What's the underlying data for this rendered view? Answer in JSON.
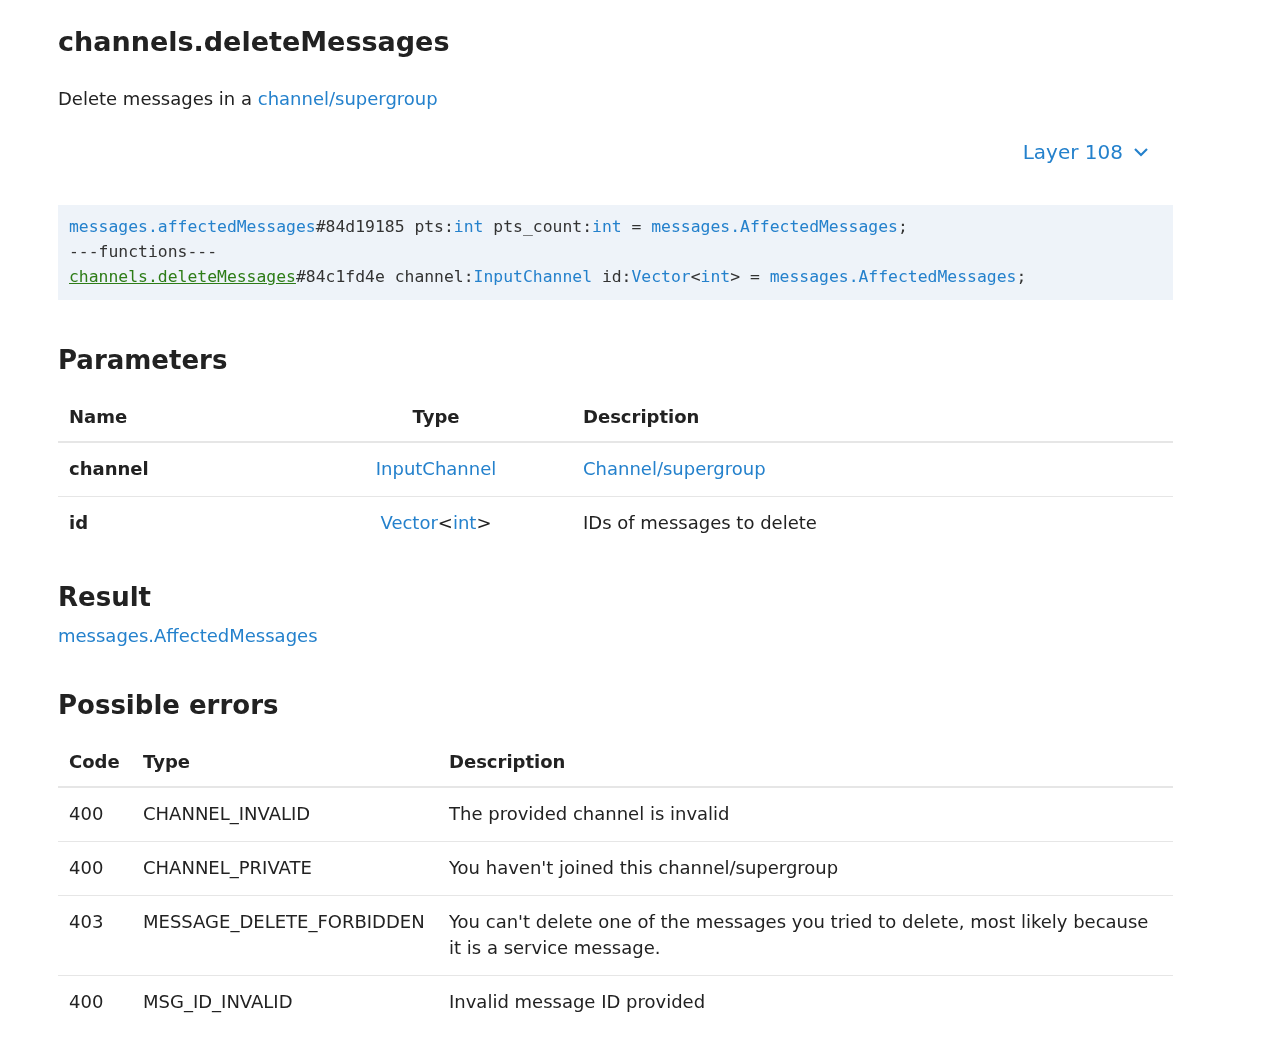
{
  "title": "channels.deleteMessages",
  "description": [
    {
      "kind": "plain",
      "text": "Delete messages in a "
    },
    {
      "kind": "link",
      "text": "channel/supergroup"
    }
  ],
  "layer_selector": {
    "label": "Layer 108"
  },
  "schema": [
    [
      {
        "kind": "link",
        "text": "messages.affectedMessages"
      },
      {
        "kind": "plain",
        "text": "#84d19185 pts:"
      },
      {
        "kind": "link",
        "text": "int"
      },
      {
        "kind": "plain",
        "text": " pts_count:"
      },
      {
        "kind": "link",
        "text": "int"
      },
      {
        "kind": "plain",
        "text": " = "
      },
      {
        "kind": "link",
        "text": "messages.AffectedMessages"
      },
      {
        "kind": "plain",
        "text": ";"
      }
    ],
    [
      {
        "kind": "plain",
        "text": "---functions---"
      }
    ],
    [
      {
        "kind": "current",
        "text": "channels.deleteMessages"
      },
      {
        "kind": "plain",
        "text": "#84c1fd4e channel:"
      },
      {
        "kind": "link",
        "text": "InputChannel"
      },
      {
        "kind": "plain",
        "text": " id:"
      },
      {
        "kind": "link",
        "text": "Vector"
      },
      {
        "kind": "plain",
        "text": "<"
      },
      {
        "kind": "link",
        "text": "int"
      },
      {
        "kind": "plain",
        "text": "> = "
      },
      {
        "kind": "link",
        "text": "messages.AffectedMessages"
      },
      {
        "kind": "plain",
        "text": ";"
      }
    ]
  ],
  "parameters": {
    "heading": "Parameters",
    "columns": [
      "Name",
      "Type",
      "Description"
    ],
    "rows": [
      {
        "name": "channel",
        "type": [
          {
            "kind": "link",
            "text": "InputChannel"
          }
        ],
        "description": [
          {
            "kind": "link",
            "text": "Channel/supergroup"
          }
        ]
      },
      {
        "name": "id",
        "type": [
          {
            "kind": "link",
            "text": "Vector"
          },
          {
            "kind": "plain",
            "text": "<"
          },
          {
            "kind": "link",
            "text": "int"
          },
          {
            "kind": "plain",
            "text": ">"
          }
        ],
        "description": [
          {
            "kind": "plain",
            "text": "IDs of messages to delete"
          }
        ]
      }
    ]
  },
  "result": {
    "heading": "Result",
    "type": "messages.AffectedMessages"
  },
  "errors": {
    "heading": "Possible errors",
    "columns": [
      "Code",
      "Type",
      "Description"
    ],
    "rows": [
      {
        "code": "400",
        "type": "CHANNEL_INVALID",
        "description": "The provided channel is invalid"
      },
      {
        "code": "400",
        "type": "CHANNEL_PRIVATE",
        "description": "You haven't joined this channel/supergroup"
      },
      {
        "code": "403",
        "type": "MESSAGE_DELETE_FORBIDDEN",
        "description": "You can't delete one of the messages you tried to delete, most likely because it is a service message."
      },
      {
        "code": "400",
        "type": "MSG_ID_INVALID",
        "description": "Invalid message ID provided"
      }
    ]
  }
}
